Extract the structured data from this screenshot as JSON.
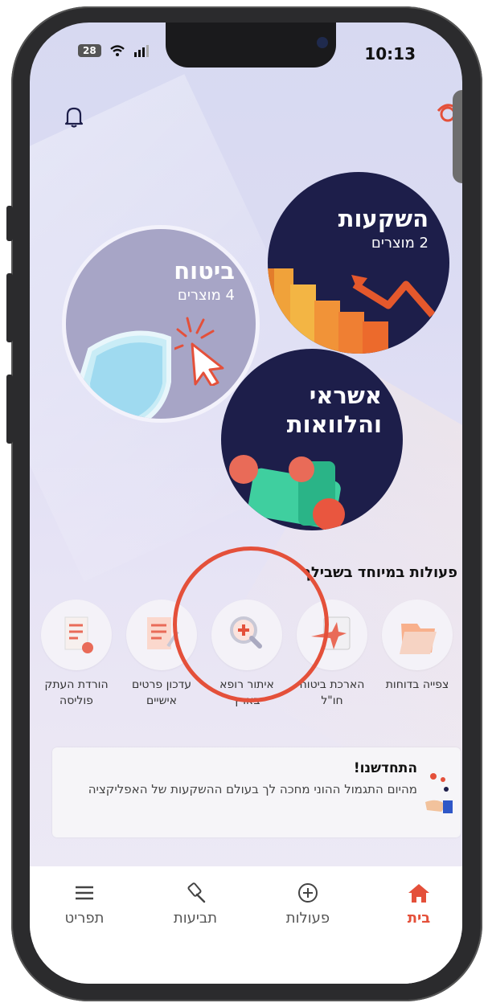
{
  "status_bar": {
    "time": "10:13",
    "battery": "28"
  },
  "header": {
    "bell_icon": "bell-icon",
    "logo_icon": "app-logo-icon"
  },
  "categories": {
    "investments": {
      "title": "השקעות",
      "subtitle": "2 מוצרים"
    },
    "insurance": {
      "title": "ביטוח",
      "subtitle": "4 מוצרים"
    },
    "credit": {
      "title": "אשראי והלוואות"
    }
  },
  "special_actions": {
    "title": "פעולות במיוחד בשבילך",
    "items": [
      {
        "label": "צפייה בדוחות",
        "icon": "folder-icon"
      },
      {
        "label": "הארכת ביטוח חו\"ל",
        "icon": "calendar-plane-icon"
      },
      {
        "label": "איתור רופא בארץ",
        "icon": "search-doctor-icon"
      },
      {
        "label": "עדכון פרטים אישיים",
        "icon": "edit-document-icon"
      },
      {
        "label": "הורדת העתק פוליסה",
        "icon": "policy-download-icon"
      }
    ]
  },
  "news": {
    "title": "התחדשנו!",
    "body": "מהיום התגמול ההוני מחכה לך בעולם ההשקעות של האפליקציה"
  },
  "bottom_nav": {
    "items": [
      {
        "label": "בית",
        "icon": "home-icon",
        "active": true
      },
      {
        "label": "פעולות",
        "icon": "plus-circle-icon"
      },
      {
        "label": "תביעות",
        "icon": "hammer-icon"
      },
      {
        "label": "תפריט",
        "icon": "menu-icon"
      }
    ]
  },
  "colors": {
    "accent": "#e4503a",
    "circle_dark": "#1d1e4a",
    "circle_insurance": "#a7a5c6"
  }
}
